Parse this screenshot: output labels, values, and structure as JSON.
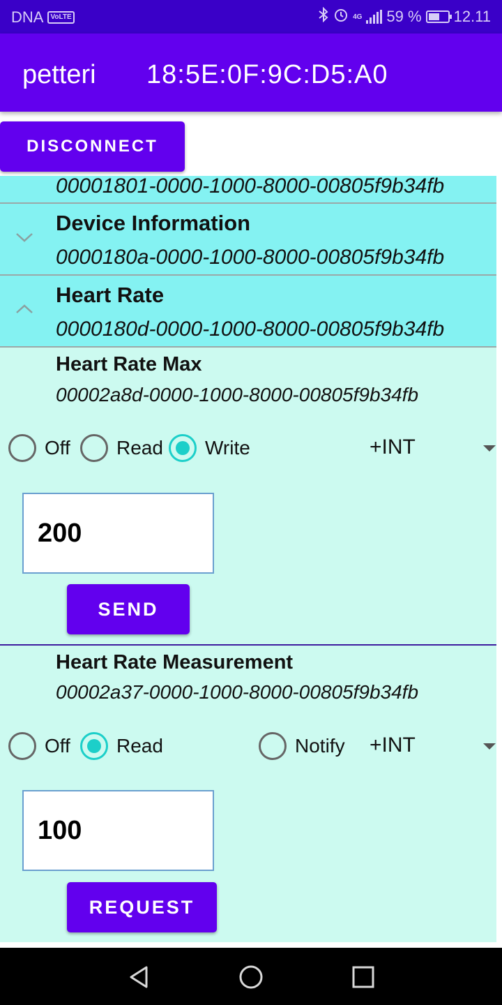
{
  "status_bar": {
    "carrier": "DNA",
    "volte": "VoLTE",
    "network": "4G",
    "battery_percent": "59 %",
    "battery_level": 0.59,
    "time": "12.11",
    "icons": [
      "bluetooth-icon",
      "alarm-icon",
      "signal-icon",
      "battery-icon"
    ]
  },
  "app_bar": {
    "device_name": "petteri",
    "device_address": "18:5E:0F:9C:D5:A0"
  },
  "disconnect_label": "DISCONNECT",
  "services": [
    {
      "title": "",
      "uuid": "00001801-0000-1000-8000-00805f9b34fb"
    },
    {
      "title": "Device Information",
      "uuid": "0000180a-0000-1000-8000-00805f9b34fb",
      "expanded": false
    },
    {
      "title": "Heart Rate",
      "uuid": "0000180d-0000-1000-8000-00805f9b34fb",
      "expanded": true
    }
  ],
  "characteristics": [
    {
      "title": "Heart Rate Max",
      "uuid": "00002a8d-0000-1000-8000-00805f9b34fb",
      "options": [
        "Off",
        "Read",
        "Write"
      ],
      "selected": "Write",
      "format": "+INT",
      "value": "200",
      "action_label": "SEND"
    },
    {
      "title": "Heart Rate Measurement",
      "uuid": "00002a37-0000-1000-8000-00805f9b34fb",
      "options": [
        "Off",
        "Read",
        "Notify"
      ],
      "selected": "Read",
      "format": "+INT",
      "value": "100",
      "action_label": "REQUEST"
    }
  ],
  "colors": {
    "status_bar": "#3a00c8",
    "primary": "#6200ee",
    "service_bg": "#84f2f2",
    "characteristic_bg": "#ccfaf0",
    "radio_checked": "#1ccfc9"
  },
  "nav_bar": {
    "icons": [
      "back-icon",
      "home-icon",
      "recents-icon"
    ]
  }
}
